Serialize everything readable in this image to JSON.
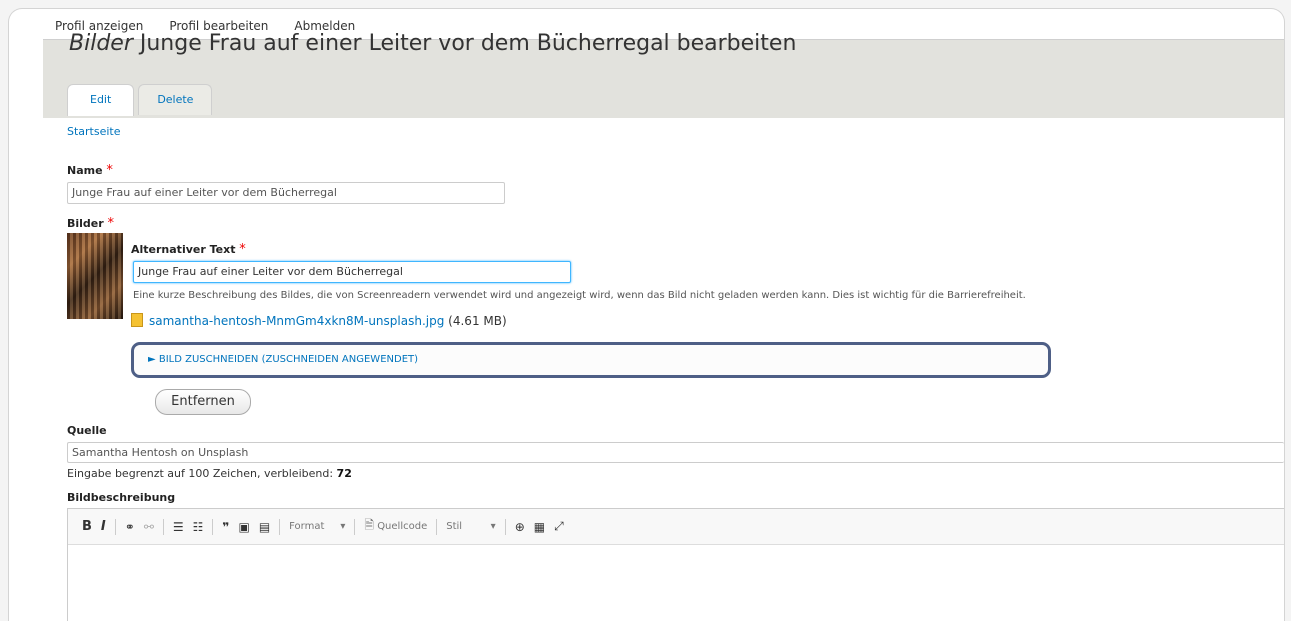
{
  "topnav": {
    "items": [
      "Profil anzeigen",
      "Profil bearbeiten",
      "Abmelden"
    ]
  },
  "header": {
    "title_prefix": "Bilder",
    "title_rest": " Junge Frau auf einer Leiter vor dem Bücherregal bearbeiten",
    "tabs": [
      {
        "label": "Edit",
        "active": true
      },
      {
        "label": "Delete",
        "active": false
      }
    ]
  },
  "breadcrumb": "Startseite",
  "form": {
    "name_label": "Name",
    "required_mark": "*",
    "name_value": "Junge Frau auf einer Leiter vor dem Bücherregal",
    "bilder_label": "Bilder",
    "alt_label": "Alternativer Text",
    "alt_value": "Junge Frau auf einer Leiter vor dem Bücherregal",
    "alt_help": "Eine kurze Beschreibung des Bildes, die von Screenreadern verwendet wird und angezeigt wird, wenn das Bild nicht geladen werden kann. Dies ist wichtig für die Barrierefreiheit.",
    "file_name": "samantha-hentosh-MnmGm4xkn8M-unsplash.jpg",
    "file_size": "(4.61 MB)",
    "crop_label": "► BILD ZUSCHNEIDEN (ZUSCHNEIDEN ANGEWENDET)",
    "remove_button": "Entfernen",
    "quelle_label": "Quelle",
    "quelle_value": "Samantha Hentosh on Unsplash",
    "counter_text": "Eingabe begrenzt auf 100 Zeichen, verbleibend: ",
    "counter_value": "72",
    "bildbeschreibung_label": "Bildbeschreibung"
  },
  "editor_toolbar": {
    "bold": "B",
    "italic": "I",
    "format": "Format",
    "source": "Quellcode",
    "style": "Stil"
  }
}
